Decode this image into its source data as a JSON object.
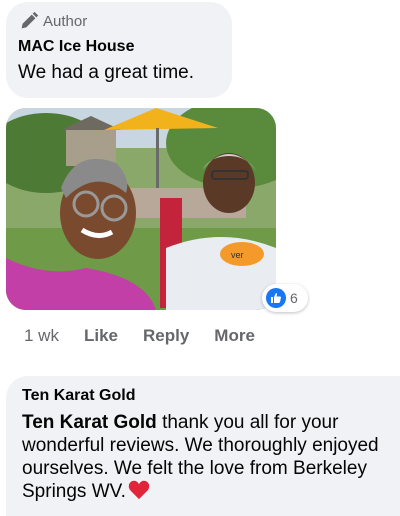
{
  "comment1": {
    "badge": {
      "icon": "pen-icon",
      "label": "Author"
    },
    "author": "MAC Ice House",
    "text": "We had a great time."
  },
  "photo": {
    "icon": "photo-selfie"
  },
  "reactions": {
    "icon": "thumbs-up-icon",
    "count": "6",
    "color": "#1877f2"
  },
  "actions": {
    "time": "1 wk",
    "like": "Like",
    "reply": "Reply",
    "more": "More"
  },
  "comment2": {
    "author": "Ten Karat Gold",
    "mention": "Ten Karat Gold",
    "text": "thank you all for your wonderful reviews. We thoroughly enjoyed ourselves. We felt the love from Berkeley Springs WV.",
    "emoji": "heart-emoji"
  }
}
